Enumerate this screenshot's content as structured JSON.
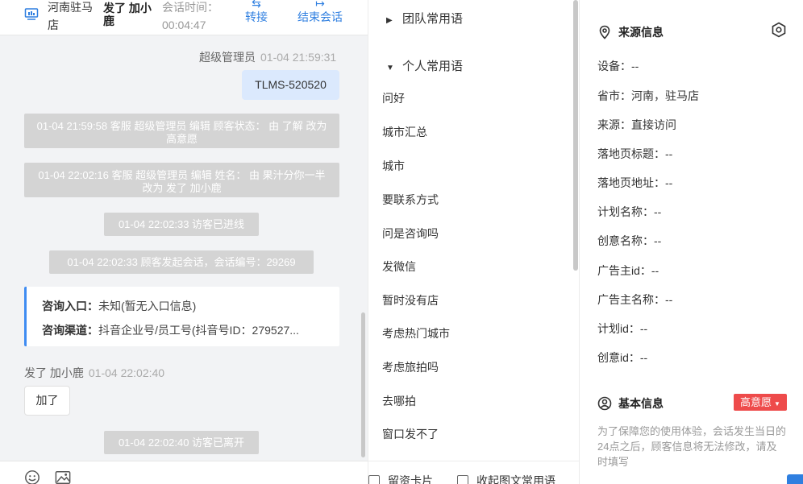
{
  "header": {
    "store": "河南驻马店",
    "customer_name": "发了 加小鹿",
    "session_time_label": "会话时间：",
    "session_time": "00:04:47",
    "transfer_label": "转接",
    "end_label": "结束会话",
    "accent": "#2f7fe0"
  },
  "messages": {
    "agent_name": "超级管理员",
    "agent_time": "01-04 21:59:31",
    "agent_text": "TLMS-520520",
    "sys1": "01-04 21:59:58 客服 超级管理员 编辑 顾客状态： 由 了解 改为 高意愿",
    "sys2": "01-04 22:02:16 客服 超级管理员 编辑 姓名： 由 果汁分你一半 改为 发了 加小鹿",
    "sys3": "01-04 22:02:33 访客已进线",
    "sys4": "01-04 22:02:33 顾客发起会话，会话编号：29269",
    "card_entry_label": "咨询入口：",
    "card_entry_value": "未知(暂无入口信息)",
    "card_channel_label": "咨询渠道：",
    "card_channel_value": "抖音企业号/员工号(抖音号ID：279527...",
    "user_name": "发了 加小鹿",
    "user_time": "01-04 22:02:40",
    "user_text": "加了",
    "sys5": "01-04 22:02:40 访客已离开"
  },
  "phrases": {
    "team_group": "团队常用语",
    "personal_group": "个人常用语",
    "items": [
      "问好",
      "城市汇总",
      "城市",
      "要联系方式",
      "问是咨询吗",
      "发微信",
      "暂时没有店",
      "考虑热门城市",
      "考虑旅拍吗",
      "去哪拍",
      "窗口发不了"
    ],
    "footer_card": "留资卡片",
    "footer_collapse": "收起图文常用语"
  },
  "info": {
    "source_title": "来源信息",
    "rows": [
      "设备：--",
      "省市：河南，驻马店",
      "来源：直接访问",
      "落地页标题：--",
      "落地页地址：--",
      "计划名称：--",
      "创意名称：--",
      "广告主id：--",
      "广告主名称：--",
      "计划id：--",
      "创意id：--"
    ],
    "basic_title": "基本信息",
    "intent_badge": "高意愿",
    "notice": "为了保障您的使用体验，会话发生当日的24点之后，顾客信息将无法修改，请及时填写",
    "badge_color": "#ee4b4b"
  }
}
